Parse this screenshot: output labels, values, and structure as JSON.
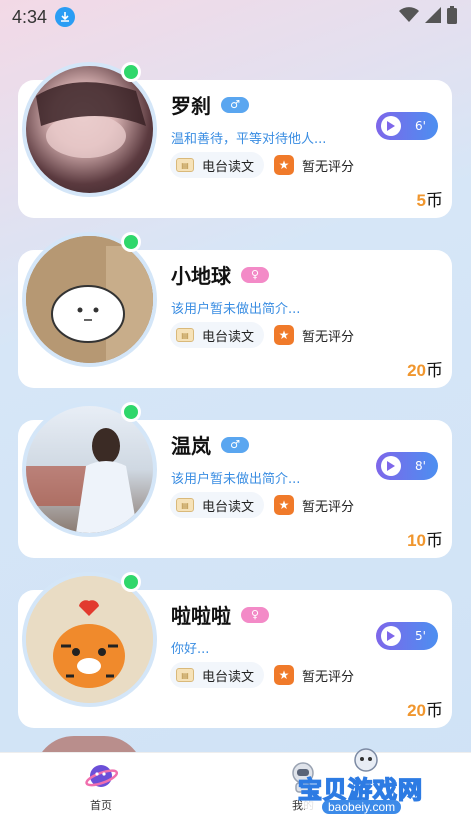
{
  "status_bar": {
    "time": "4:34"
  },
  "users": [
    {
      "name": "罗刹",
      "gender": "male",
      "bio": "温和善待，平等对待他人...",
      "tag_radio": "电台读文",
      "tag_rating": "暂无评分",
      "price": "5",
      "price_unit": "币",
      "voice": "6'"
    },
    {
      "name": "小地球",
      "gender": "female",
      "bio": "该用户暂未做出简介...",
      "tag_radio": "电台读文",
      "tag_rating": "暂无评分",
      "price": "20",
      "price_unit": "币",
      "voice": ""
    },
    {
      "name": "温岚",
      "gender": "male",
      "bio": "该用户暂未做出简介...",
      "tag_radio": "电台读文",
      "tag_rating": "暂无评分",
      "price": "10",
      "price_unit": "币",
      "voice": "8'"
    },
    {
      "name": "啦啦啦",
      "gender": "female",
      "bio": "你好...",
      "tag_radio": "电台读文",
      "tag_rating": "暂无评分",
      "price": "20",
      "price_unit": "币",
      "voice": "5'"
    }
  ],
  "tab_bar": {
    "home_label": "首页",
    "mine_label": "我的"
  },
  "watermark": {
    "text": "宝贝游戏网",
    "sub": "baobeiy.com"
  },
  "colors": {
    "accent_blue": "#3a8de2",
    "price_orange": "#f0962e",
    "online_green": "#2fd76b",
    "voice_gradient_start": "#7e67ea",
    "voice_gradient_end": "#4c8ff0"
  }
}
